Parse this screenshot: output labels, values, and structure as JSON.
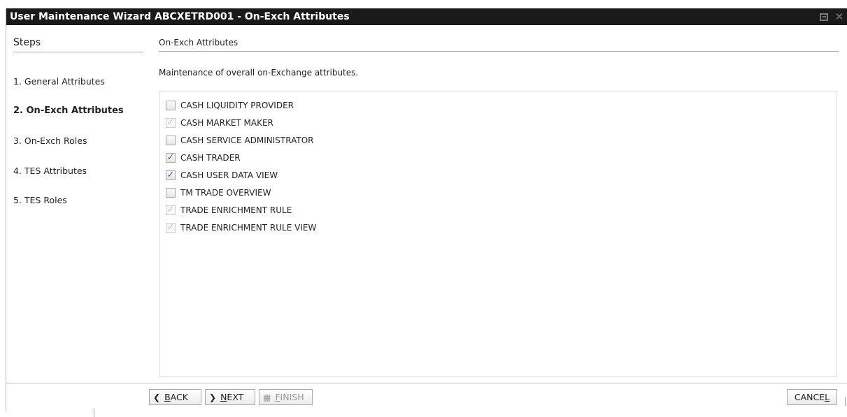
{
  "window": {
    "title": "User Maintenance Wizard ABCXETRD001 - On-Exch Attributes"
  },
  "steps": {
    "header": "Steps",
    "items": [
      {
        "label": "1. General Attributes",
        "active": false
      },
      {
        "label": "2. On-Exch Attributes",
        "active": true
      },
      {
        "label": "3. On-Exch Roles",
        "active": false
      },
      {
        "label": "4. TES Attributes",
        "active": false
      },
      {
        "label": "5. TES Roles",
        "active": false
      }
    ]
  },
  "content": {
    "title": "On-Exch Attributes",
    "description": "Maintenance of overall on-Exchange attributes.",
    "attributes": [
      {
        "label": "CASH LIQUIDITY PROVIDER",
        "checked": false,
        "enabled": true
      },
      {
        "label": "CASH MARKET MAKER",
        "checked": true,
        "enabled": false
      },
      {
        "label": "CASH SERVICE ADMINISTRATOR",
        "checked": false,
        "enabled": true
      },
      {
        "label": "CASH TRADER",
        "checked": true,
        "enabled": true
      },
      {
        "label": "CASH USER DATA VIEW",
        "checked": true,
        "enabled": true
      },
      {
        "label": "TM TRADE OVERVIEW",
        "checked": false,
        "enabled": true
      },
      {
        "label": "TRADE ENRICHMENT RULE",
        "checked": true,
        "enabled": false
      },
      {
        "label": "TRADE ENRICHMENT RULE VIEW",
        "checked": true,
        "enabled": false
      }
    ]
  },
  "footer": {
    "back": {
      "label": "BACK",
      "icon": "chevron-left-icon"
    },
    "next": {
      "label": "NEXT",
      "icon": "chevron-right-icon"
    },
    "finish": {
      "label": "FINISH",
      "icon": "checkered-flag-icon",
      "enabled": false
    },
    "cancel": {
      "label": "CANCEL"
    }
  }
}
